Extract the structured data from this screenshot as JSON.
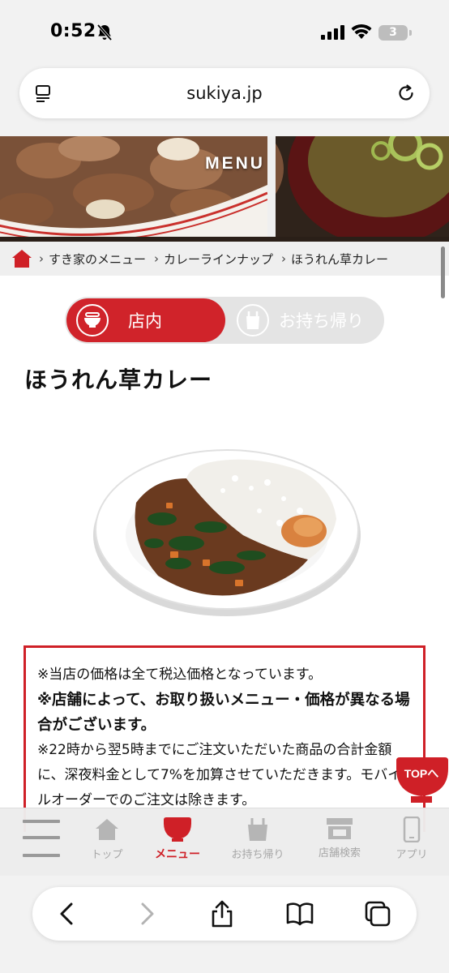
{
  "status_bar": {
    "time": "0:52",
    "battery_level": "3"
  },
  "browser": {
    "url": "sukiya.jp"
  },
  "hero": {
    "title": "MENU"
  },
  "breadcrumb": {
    "items": [
      "すき家のメニュー",
      "カレーラインナップ",
      "ほうれん草カレー"
    ]
  },
  "toggle": {
    "active_label": "店内",
    "inactive_label": "お持ち帰り"
  },
  "product": {
    "title": "ほうれん草カレー"
  },
  "notice": {
    "line1": "※当店の価格は全て税込価格となっています。",
    "line2": "※店舗によって、お取り扱いメニュー・価格が異なる場合がございます。",
    "line3": "※22時から翌5時までにご注文いただいた商品の合計金額に、深夜料金として7%を加算させていただきます。モバイルオーダーでのご注文は除きます。"
  },
  "top_button": {
    "label": "TOPへ"
  },
  "site_nav": {
    "items": [
      {
        "label": "トップ",
        "icon": "home-icon"
      },
      {
        "label": "メニュー",
        "icon": "bowl-icon"
      },
      {
        "label": "お持ち帰り",
        "icon": "bag-icon"
      },
      {
        "label": "店舗検索",
        "icon": "store-icon"
      },
      {
        "label": "アプリ",
        "icon": "phone-icon"
      }
    ],
    "active_index": 1
  },
  "colors": {
    "brand_red": "#cf2027",
    "inactive_gray": "#a6a6a6"
  }
}
